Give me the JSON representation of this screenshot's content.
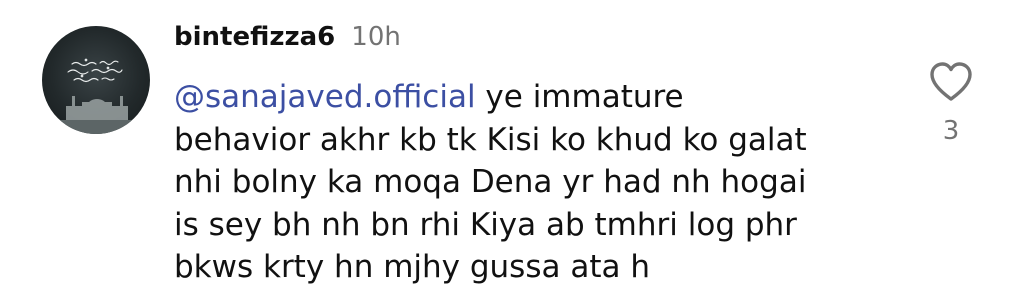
{
  "comment": {
    "avatar_icon": "profile-picture-dark-calligraphy-mosque",
    "username": "bintefizza6",
    "timestamp": "10h",
    "mention": "@sanajaved.official",
    "text_lines": [
      " ye immature",
      "behavior akhr kb tk Kisi ko khud ko galat",
      "nhi bolny ka moqa Dena yr had nh hogai",
      "is sey bh nh bn rhi Kiya ab tmhri log phr",
      "bkws krty hn mjhy gussa ata h"
    ],
    "like_icon": "heart-outline-icon",
    "like_count": "3"
  },
  "colors": {
    "mention": "#3c4fa3",
    "muted": "#737373",
    "text": "#111111"
  }
}
